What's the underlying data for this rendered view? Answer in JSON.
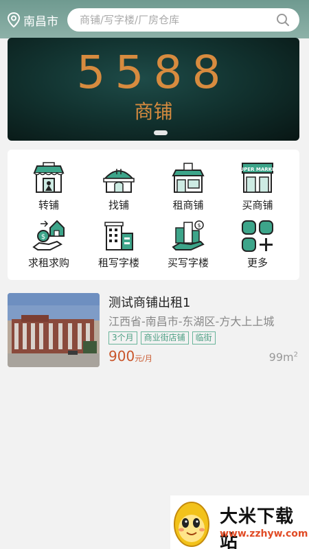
{
  "header": {
    "city": "南昌市",
    "search_placeholder": "商铺/写字楼/厂房仓库"
  },
  "banner": {
    "number": "5588",
    "subtitle": "商铺"
  },
  "categories": [
    {
      "label": "转铺",
      "icon": "shop-transfer-icon"
    },
    {
      "label": "找铺",
      "icon": "restaurant-shop-icon"
    },
    {
      "label": "租商铺",
      "icon": "coffee-shop-icon"
    },
    {
      "label": "买商铺",
      "icon": "supermarket-icon"
    },
    {
      "label": "求租求购",
      "icon": "house-money-hand-icon"
    },
    {
      "label": "租写字楼",
      "icon": "office-building-icon"
    },
    {
      "label": "买写字楼",
      "icon": "buildings-money-hand-icon"
    },
    {
      "label": "更多",
      "icon": "more-grid-icon"
    }
  ],
  "banner_icon_text": "SUPER MARKET",
  "listing": {
    "title": "测试商铺出租1",
    "address": "江西省-南昌市-东湖区-方大上上城",
    "tags": [
      "3个月",
      "商业街店铺",
      "临街"
    ],
    "price": "900",
    "price_unit": "元/月",
    "area": "99m",
    "area_sup": "2"
  },
  "watermark": {
    "name": "大米下载站",
    "url": "www.zzhyw.com"
  },
  "colors": {
    "header": "#7ea69c",
    "accent_orange": "#d78b3f",
    "tag_green": "#4a9e82",
    "price": "#c9562b"
  }
}
